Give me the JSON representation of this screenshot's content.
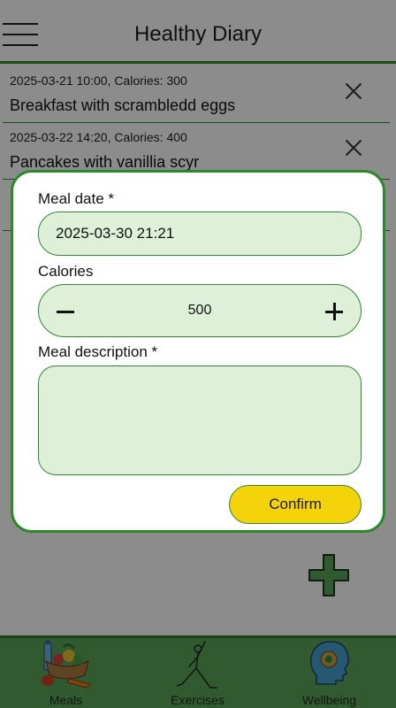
{
  "header": {
    "title": "Healthy Diary"
  },
  "meals": [
    {
      "meta": "2025-03-21 10:00, Calories: 300",
      "description": "Breakfast with scrambledd eggs"
    },
    {
      "meta": "2025-03-22 14:20, Calories: 400",
      "description": "Pancakes with vanillia scyr"
    },
    {
      "meta": "",
      "description": ""
    }
  ],
  "nav": {
    "meals_label": "Meals",
    "exercises_label": "Exercises",
    "wellbeing_label": "Wellbeing"
  },
  "modal": {
    "date_label": "Meal date *",
    "date_value": "2025-03-30 21:21",
    "calories_label": "Calories",
    "calories_value": "500",
    "description_label": "Meal description *",
    "description_value": "",
    "confirm_label": "Confirm"
  },
  "colors": {
    "accent_green": "#2f8a2f",
    "field_fill": "#def0d8",
    "nav_bg": "#5aa55a",
    "confirm_yellow": "#f5d30a"
  },
  "icons": {
    "menu": "hamburger-icon",
    "delete": "close-icon",
    "add": "plus-icon",
    "meals": "groceries-icon",
    "exercises": "yoga-pose-icon",
    "wellbeing": "mind-head-icon"
  }
}
